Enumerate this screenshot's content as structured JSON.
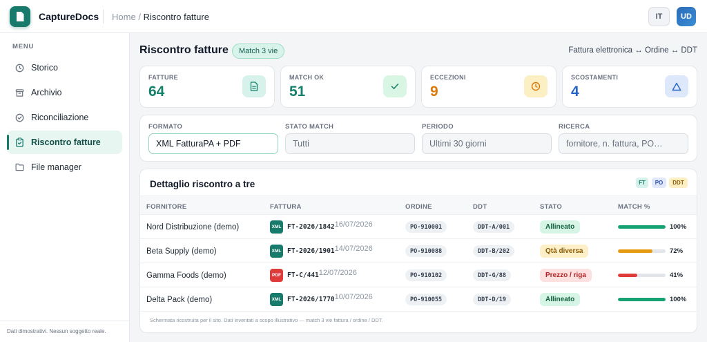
{
  "app": {
    "name": "CaptureDocs",
    "breadcrumb_root": "Home",
    "breadcrumb_sep": "/",
    "breadcrumb_current": "Riscontro fatture",
    "lang": "IT",
    "user_initials": "UD",
    "accent": "#177a6a"
  },
  "sidebar": {
    "title": "MENU",
    "items": [
      {
        "label": "Storico",
        "icon": "clock-icon",
        "active": false
      },
      {
        "label": "Archivio",
        "icon": "archive-icon",
        "active": false
      },
      {
        "label": "Riconciliazione",
        "icon": "check-circle-icon",
        "active": false
      },
      {
        "label": "Riscontro fatture",
        "icon": "clipboard-check-icon",
        "active": true
      },
      {
        "label": "File manager",
        "icon": "folder-icon",
        "active": false
      }
    ],
    "footer": "Dati dimostrativi. Nessun soggetto reale."
  },
  "page": {
    "title": "Riscontro fatture",
    "badge": "Match 3 vie",
    "flow": "Fattura elettronica ↔ Ordine ↔ DDT"
  },
  "stats": [
    {
      "label": "FATTURE",
      "value": "64",
      "color": "#15806c",
      "icon": "document-icon",
      "icon_bg": "#d6f2ea"
    },
    {
      "label": "MATCH OK",
      "value": "51",
      "color": "#15806c",
      "icon": "check-icon",
      "icon_bg": "#d9f5e3"
    },
    {
      "label": "ECCEZIONI",
      "value": "9",
      "color": "#d97a0b",
      "icon": "clock-icon",
      "icon_bg": "#fdefc4"
    },
    {
      "label": "SCOSTAMENTI",
      "value": "4",
      "color": "#2563c7",
      "icon": "warning-triangle-icon",
      "icon_bg": "#dde8fb"
    }
  ],
  "filters": [
    {
      "label": "FORMATO",
      "value": "XML FatturaPA + PDF",
      "selected": true
    },
    {
      "label": "STATO MATCH",
      "value": "Tutti",
      "selected": false
    },
    {
      "label": "PERIODO",
      "value": "Ultimi 30 giorni",
      "selected": false
    },
    {
      "label": "RICERCA",
      "placeholder": "fornitore, n. fattura, PO…",
      "selected": false
    }
  ],
  "table": {
    "title": "Dettaglio riscontro a tre",
    "legend": [
      {
        "label": "FT",
        "bg": "#d6f2ea",
        "color": "#15806c"
      },
      {
        "label": "PO",
        "bg": "#e2e8fb",
        "color": "#2c4fa8"
      },
      {
        "label": "DDT",
        "bg": "#fdefc4",
        "color": "#8a5a05"
      }
    ],
    "columns": [
      "FORNITORE",
      "FATTURA",
      "ORDINE",
      "DDT",
      "STATO",
      "MATCH %"
    ],
    "rows": [
      {
        "supplier": "Nord Distribuzione (demo)",
        "ftype": "XML",
        "invoice": "FT-2026/1842",
        "date": "16/07/2026",
        "order": "PO-910001",
        "ddt": "DDT-A/001",
        "status": "Allineato",
        "status_kind": "ok",
        "match": 100,
        "match_label": "100%"
      },
      {
        "supplier": "Beta Supply (demo)",
        "ftype": "XML",
        "invoice": "FT-2026/1901",
        "date": "14/07/2026",
        "order": "PO-910088",
        "ddt": "DDT-B/202",
        "status": "Qtà diversa",
        "status_kind": "warn",
        "match": 72,
        "match_label": "72%"
      },
      {
        "supplier": "Gamma Foods (demo)",
        "ftype": "PDF",
        "invoice": "FT-C/441",
        "date": "12/07/2026",
        "order": "PO-910102",
        "ddt": "DDT-G/88",
        "status": "Prezzo / riga",
        "status_kind": "err",
        "match": 41,
        "match_label": "41%"
      },
      {
        "supplier": "Delta Pack (demo)",
        "ftype": "XML",
        "invoice": "FT-2026/1770",
        "date": "10/07/2026",
        "order": "PO-910055",
        "ddt": "DDT-D/19",
        "status": "Allineato",
        "status_kind": "ok",
        "match": 100,
        "match_label": "100%"
      }
    ],
    "footnote": "Schermata ricostruita per il sito. Dati inventati a scopo illustrativo — match 3 vie fattura / ordine / DDT."
  }
}
